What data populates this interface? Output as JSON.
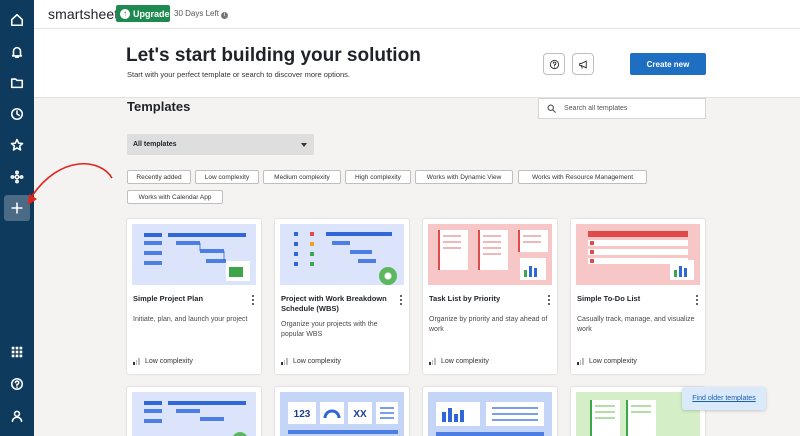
{
  "app": {
    "logo": "smartsheet",
    "upgrade_label": "Upgrade",
    "trial": "30 Days Left"
  },
  "sidebar": {
    "items": [
      {
        "icon": "home-icon"
      },
      {
        "icon": "bell-icon"
      },
      {
        "icon": "folder-icon"
      },
      {
        "icon": "clock-icon"
      },
      {
        "icon": "star-icon"
      },
      {
        "icon": "hub-icon"
      },
      {
        "icon": "plus-icon",
        "active": true
      },
      {
        "icon": "apps-grid-icon"
      },
      {
        "icon": "help-icon"
      },
      {
        "icon": "profile-icon"
      }
    ]
  },
  "header": {
    "title": "Let's start building your solution",
    "subtitle": "Start with your perfect template or search to discover more options.",
    "help_icon": "question-icon",
    "announce_icon": "megaphone-icon",
    "create_label": "Create new"
  },
  "templates": {
    "heading": "Templates",
    "search_placeholder": "Search all templates",
    "filter_selected": "All templates",
    "chips": [
      "Recently added",
      "Low complexity",
      "Medium complexity",
      "High complexity",
      "Works with Dynamic View",
      "Works with Resource Management",
      "Works with Calendar App"
    ],
    "cards": [
      {
        "title": "Simple Project Plan",
        "desc": "Initiate, plan, and launch your project",
        "complexity": "Low complexity",
        "theme": "blue"
      },
      {
        "title": "Project with Work Breakdown Schedule (WBS)",
        "desc": "Organize your projects with the popular WBS",
        "complexity": "Low complexity",
        "theme": "blue"
      },
      {
        "title": "Task List by Priority",
        "desc": "Organize by priority and stay ahead of work",
        "complexity": "Low complexity",
        "theme": "red"
      },
      {
        "title": "Simple To-Do List",
        "desc": "Casually track, manage, and visualize work",
        "complexity": "Low complexity",
        "theme": "red"
      }
    ],
    "second_row_thumb_text": [
      "123",
      "XX"
    ],
    "older_link": "Find older templates"
  },
  "colors": {
    "sidebar": "#0e3a5d",
    "primary": "#1e6fc2",
    "upgrade": "#1f8a50",
    "blue_thumb": "#dbe4fb",
    "red_thumb": "#f7c7c8",
    "green_thumb": "#d4efc7"
  }
}
